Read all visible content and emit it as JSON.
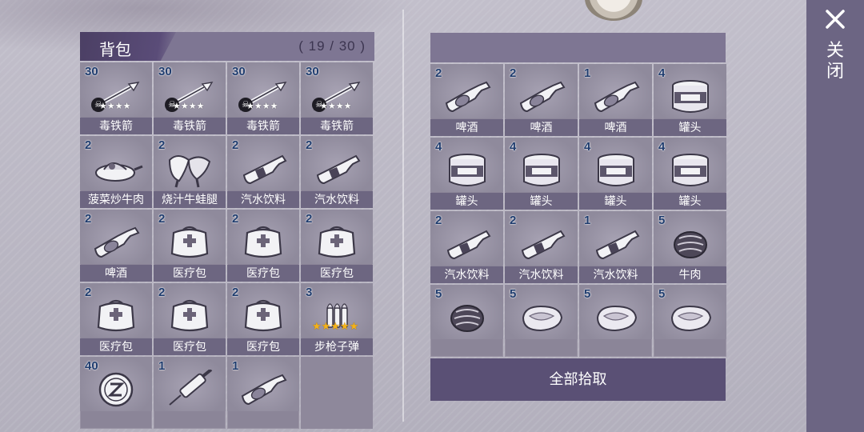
{
  "inventory": {
    "title": "背包",
    "count": "( 19 / 30 )",
    "items": [
      {
        "qty": "30",
        "label": "毒铁箭",
        "icon": "arrow-icon",
        "stars": "★★★★",
        "badge": "☠"
      },
      {
        "qty": "30",
        "label": "毒铁箭",
        "icon": "arrow-icon",
        "stars": "★★★★",
        "badge": "☠"
      },
      {
        "qty": "30",
        "label": "毒铁箭",
        "icon": "arrow-icon",
        "stars": "★★★★",
        "badge": "☠"
      },
      {
        "qty": "30",
        "label": "毒铁箭",
        "icon": "arrow-icon",
        "stars": "★★★★",
        "badge": "☠"
      },
      {
        "qty": "2",
        "label": "菠菜炒牛肉",
        "icon": "stir-fry-icon"
      },
      {
        "qty": "2",
        "label": "烧汁牛蛙腿",
        "icon": "frog-legs-icon"
      },
      {
        "qty": "2",
        "label": "汽水饮料",
        "icon": "soda-bottle-icon"
      },
      {
        "qty": "2",
        "label": "汽水饮料",
        "icon": "soda-bottle-icon"
      },
      {
        "qty": "2",
        "label": "啤酒",
        "icon": "beer-bottle-icon"
      },
      {
        "qty": "2",
        "label": "医疗包",
        "icon": "medkit-icon"
      },
      {
        "qty": "2",
        "label": "医疗包",
        "icon": "medkit-icon"
      },
      {
        "qty": "2",
        "label": "医疗包",
        "icon": "medkit-icon"
      },
      {
        "qty": "2",
        "label": "医疗包",
        "icon": "medkit-icon"
      },
      {
        "qty": "2",
        "label": "医疗包",
        "icon": "medkit-icon"
      },
      {
        "qty": "2",
        "label": "医疗包",
        "icon": "medkit-icon"
      },
      {
        "qty": "3",
        "label": "步枪子弹",
        "icon": "rifle-bullets-icon",
        "stars": "★★★★★",
        "gold": true
      },
      {
        "qty": "40",
        "label": "",
        "icon": "coin-icon"
      },
      {
        "qty": "1",
        "label": "",
        "icon": "syringe-icon"
      },
      {
        "qty": "1",
        "label": "",
        "icon": "beer-bottle-icon"
      },
      {
        "qty": "",
        "label": "",
        "icon": ""
      }
    ]
  },
  "loot": {
    "items": [
      {
        "qty": "2",
        "label": "啤酒",
        "icon": "beer-bottle-icon"
      },
      {
        "qty": "2",
        "label": "啤酒",
        "icon": "beer-bottle-icon"
      },
      {
        "qty": "1",
        "label": "啤酒",
        "icon": "beer-bottle-icon"
      },
      {
        "qty": "4",
        "label": "罐头",
        "icon": "canned-food-icon"
      },
      {
        "qty": "4",
        "label": "罐头",
        "icon": "canned-food-icon"
      },
      {
        "qty": "4",
        "label": "罐头",
        "icon": "canned-food-icon"
      },
      {
        "qty": "4",
        "label": "罐头",
        "icon": "canned-food-icon"
      },
      {
        "qty": "4",
        "label": "罐头",
        "icon": "canned-food-icon"
      },
      {
        "qty": "2",
        "label": "汽水饮料",
        "icon": "soda-bottle-icon"
      },
      {
        "qty": "2",
        "label": "汽水饮料",
        "icon": "soda-bottle-icon"
      },
      {
        "qty": "1",
        "label": "汽水饮料",
        "icon": "soda-bottle-icon"
      },
      {
        "qty": "5",
        "label": "牛肉",
        "icon": "beef-icon"
      },
      {
        "qty": "5",
        "label": "",
        "icon": "beef-icon"
      },
      {
        "qty": "5",
        "label": "",
        "icon": "steak-icon"
      },
      {
        "qty": "5",
        "label": "",
        "icon": "steak-icon"
      },
      {
        "qty": "5",
        "label": "",
        "icon": "steak-icon"
      }
    ],
    "pickup_all_label": "全部拾取"
  },
  "close": {
    "label": "关闭",
    "icon": "close-icon"
  }
}
